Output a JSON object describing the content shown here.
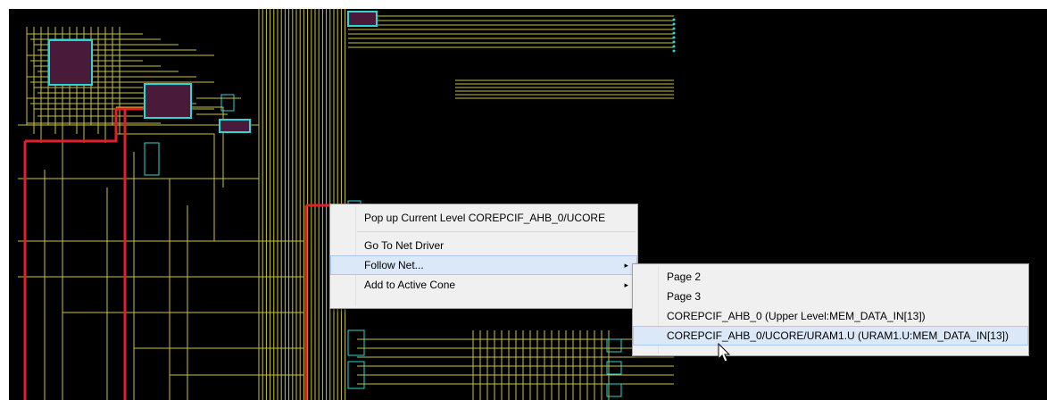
{
  "context_menu": {
    "items": [
      {
        "label": "Pop up Current Level COREPCIF_AHB_0/UCORE"
      },
      {
        "label": "Go To Net Driver"
      },
      {
        "label": "Follow Net...",
        "submenu": true,
        "arrow": "▸"
      },
      {
        "label": "Add to Active Cone",
        "submenu": true,
        "arrow": "▸"
      }
    ]
  },
  "submenu": {
    "items": [
      {
        "label": "Page 2"
      },
      {
        "label": "Page 3"
      },
      {
        "label": "COREPCIF_AHB_0 (Upper Level:MEM_DATA_IN[13])"
      },
      {
        "label": "COREPCIF_AHB_0/UCORE/URAM1.U (URAM1.U:MEM_DATA_IN[13])"
      }
    ]
  },
  "colors": {
    "canvas_bg": "#000000",
    "net_wire": "#c9c437",
    "selected_net": "#e0202a",
    "instance_fill": "#4a1a3a",
    "instance_border": "#2fd6d6"
  },
  "icons": [
    "submenu-arrow-icon",
    "mouse-pointer-icon"
  ]
}
